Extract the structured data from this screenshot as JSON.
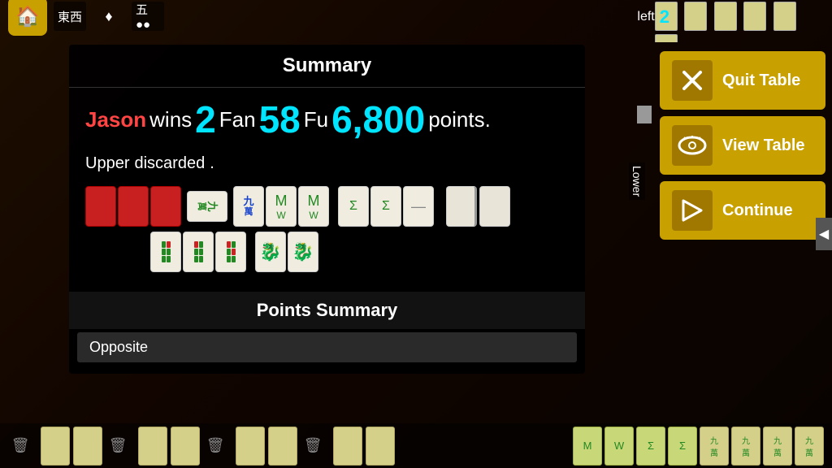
{
  "topbar": {
    "left_label": "left",
    "left_count": "2"
  },
  "summary": {
    "title": "Summary",
    "win_player": "Jason",
    "win_text_pre": " wins ",
    "win_fan_num": "2",
    "win_fan_label": "Fan",
    "win_fu_num": "58",
    "win_fu_label": "Fu",
    "win_points_num": "6,800",
    "win_points_label": " points.",
    "discard_text": "Upper",
    "discard_mid": "discarded"
  },
  "points_summary": {
    "title": "Points Summary",
    "opposite_label": "Opposite"
  },
  "buttons": {
    "quit_label": "Quit Table",
    "view_label": "View Table",
    "continue_label": "Continue"
  },
  "lower_label": "Lower",
  "icons": {
    "home": "🏠",
    "east_west": "東西",
    "diamond": "♦",
    "mahjong": "🀄",
    "quit_icon": "✕",
    "view_icon": "👁",
    "continue_icon": "▷",
    "trash": "🗑",
    "arrow_right": "◀"
  }
}
